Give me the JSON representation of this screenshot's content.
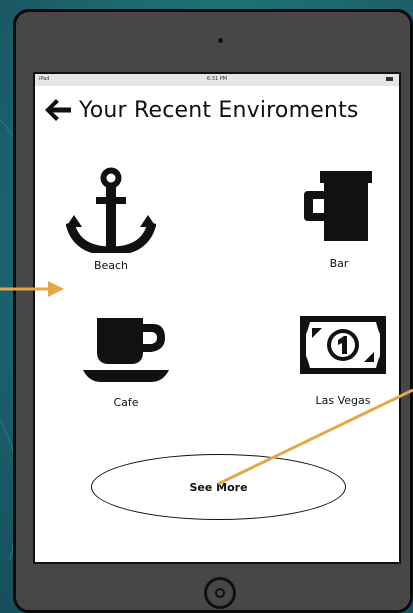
{
  "status_bar": {
    "carrier": "iPad",
    "time": "6:31 PM"
  },
  "header": {
    "title": "Your Recent Enviroments"
  },
  "environments": [
    {
      "label": "Beach",
      "icon": "anchor-icon"
    },
    {
      "label": "Bar",
      "icon": "beer-mug-icon"
    },
    {
      "label": "Cafe",
      "icon": "coffee-cup-icon"
    },
    {
      "label": "Las Vegas",
      "icon": "dollar-bill-icon"
    }
  ],
  "see_more": {
    "label": "See More"
  },
  "colors": {
    "background": "#1f6f76",
    "tablet": "#474747",
    "annotation": "#e3a84a"
  }
}
